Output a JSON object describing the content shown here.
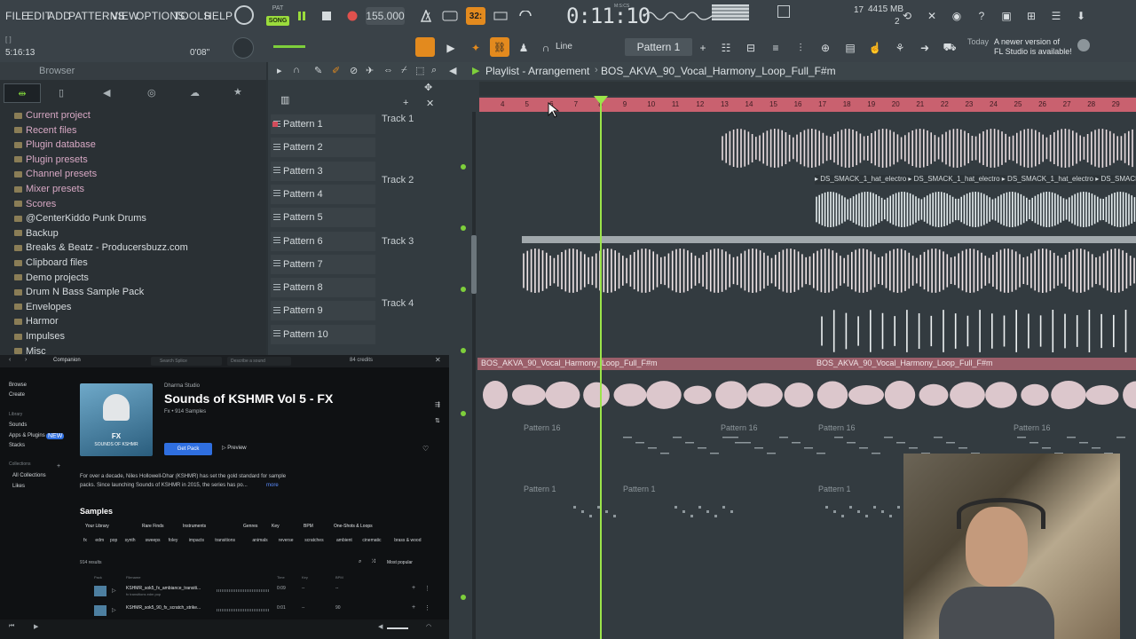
{
  "menu": [
    "FILE",
    "EDIT",
    "ADD",
    "PATTERNS",
    "VIEW",
    "OPTIONS",
    "TOOLS",
    "HELP"
  ],
  "transport": {
    "mode_pat": "PAT",
    "mode_song": "SONG",
    "tempo": "155.000",
    "time": "0:11:10",
    "time_unit": "M:S:CS",
    "step": "32:"
  },
  "perf": {
    "cpu_label": "17",
    "memory": "4415 MB",
    "voices": "2"
  },
  "hint_bar": {
    "position": "5:16:13",
    "time_offset": "0'08\""
  },
  "bar2": {
    "snap": "Line",
    "pattern": "Pattern 1",
    "news_day": "Today",
    "news_text_1": "A newer version of",
    "news_text_2": "FL Studio is available!"
  },
  "browser": {
    "title": "Browser",
    "items": [
      "Current project",
      "Recent files",
      "Plugin database",
      "Plugin presets",
      "Channel presets",
      "Mixer presets",
      "Scores",
      "@CenterKiddo Punk Drums",
      "Backup",
      "Breaks & Beatz - Producersbuzz.com",
      "Clipboard files",
      "Demo projects",
      "Drum N Bass Sample Pack",
      "Envelopes",
      "Harmor",
      "Impulses",
      "Misc"
    ]
  },
  "playlist": {
    "title": "Playlist - Arrangement",
    "breadcrumb": "BOS_AKVA_90_Vocal_Harmony_Loop_Full_F#m",
    "patterns": [
      "Pattern 1",
      "Pattern 2",
      "Pattern 3",
      "Pattern 4",
      "Pattern 5",
      "Pattern 6",
      "Pattern 7",
      "Pattern 8",
      "Pattern 9",
      "Pattern 10"
    ],
    "tracks": [
      "Track 1",
      "Track 2",
      "Track 3",
      "Track 4"
    ],
    "ruler": [
      "4",
      "5",
      "6",
      "7",
      "8",
      "9",
      "10",
      "11",
      "12",
      "13",
      "14",
      "15",
      "16",
      "17",
      "18",
      "19",
      "20",
      "21",
      "22",
      "23",
      "24",
      "25",
      "26",
      "27",
      "28",
      "29"
    ],
    "clip_hat": "DS_SMACK_1_hat_electro",
    "clip_vocal": "BOS_AKVA_90_Vocal_Harmony_Loop_Full_F#m",
    "clip_p16": "Pattern 16",
    "clip_p1": "Pattern 1"
  },
  "companion": {
    "tab": "Companion",
    "search_placeholder": "Search Splice",
    "describe_placeholder": "Describe a sound",
    "credits": "84 credits",
    "nav": [
      "Browse",
      "Create",
      "Library",
      "Sounds",
      "Apps & Plugins",
      "Stacks",
      "Collections",
      "All Collections",
      "Likes"
    ],
    "new_badge": "NEW",
    "publisher": "Dharma Studio",
    "pack_title": "Sounds of KSHMR Vol 5 - FX",
    "pack_meta": "Fx • 914 Samples",
    "cover_line1": "FX",
    "cover_line2": "SOUNDS OF KSHMR",
    "get_pack": "Get Pack",
    "preview": "Preview",
    "desc_1": "For over a decade, Niles Hollowell-Dhar (KSHMR) has set the gold standard for sample",
    "desc_2": "packs. Since launching Sounds of KSHMR in 2015, the series has po...",
    "more": "more",
    "samples_heading": "Samples",
    "filters": [
      "Your Library",
      "Rare Finds",
      "Instruments",
      "Genres",
      "Key",
      "BPM",
      "One-Shots & Loops"
    ],
    "tags": [
      "fx",
      "edm",
      "pop",
      "synth",
      "sweeps",
      "foley",
      "impacts",
      "transitions",
      "animals",
      "reverse",
      "scratches",
      "ambient",
      "cinematic",
      "brass & wood"
    ],
    "results": "914 results",
    "sort": "Most popular",
    "columns": [
      "Pack",
      "Filename",
      "Time",
      "Key",
      "BPM"
    ],
    "rows": [
      {
        "name": "KSHMR_sok5_fx_ambiance_transiti...",
        "sub": "fx transitions edm pop",
        "time": "0:09",
        "key": "--",
        "bpm": "--"
      },
      {
        "name": "KSHMR_sok5_90_fx_scratch_strike...",
        "sub": "",
        "time": "0:01",
        "key": "--",
        "bpm": "90"
      }
    ]
  },
  "colors": {
    "accent_green": "#7ecf3b",
    "playhead": "#9be44a",
    "ruler": "#c9616f",
    "clip_bar": "#9b5f6a",
    "splice_blue": "#2f6fe0"
  }
}
